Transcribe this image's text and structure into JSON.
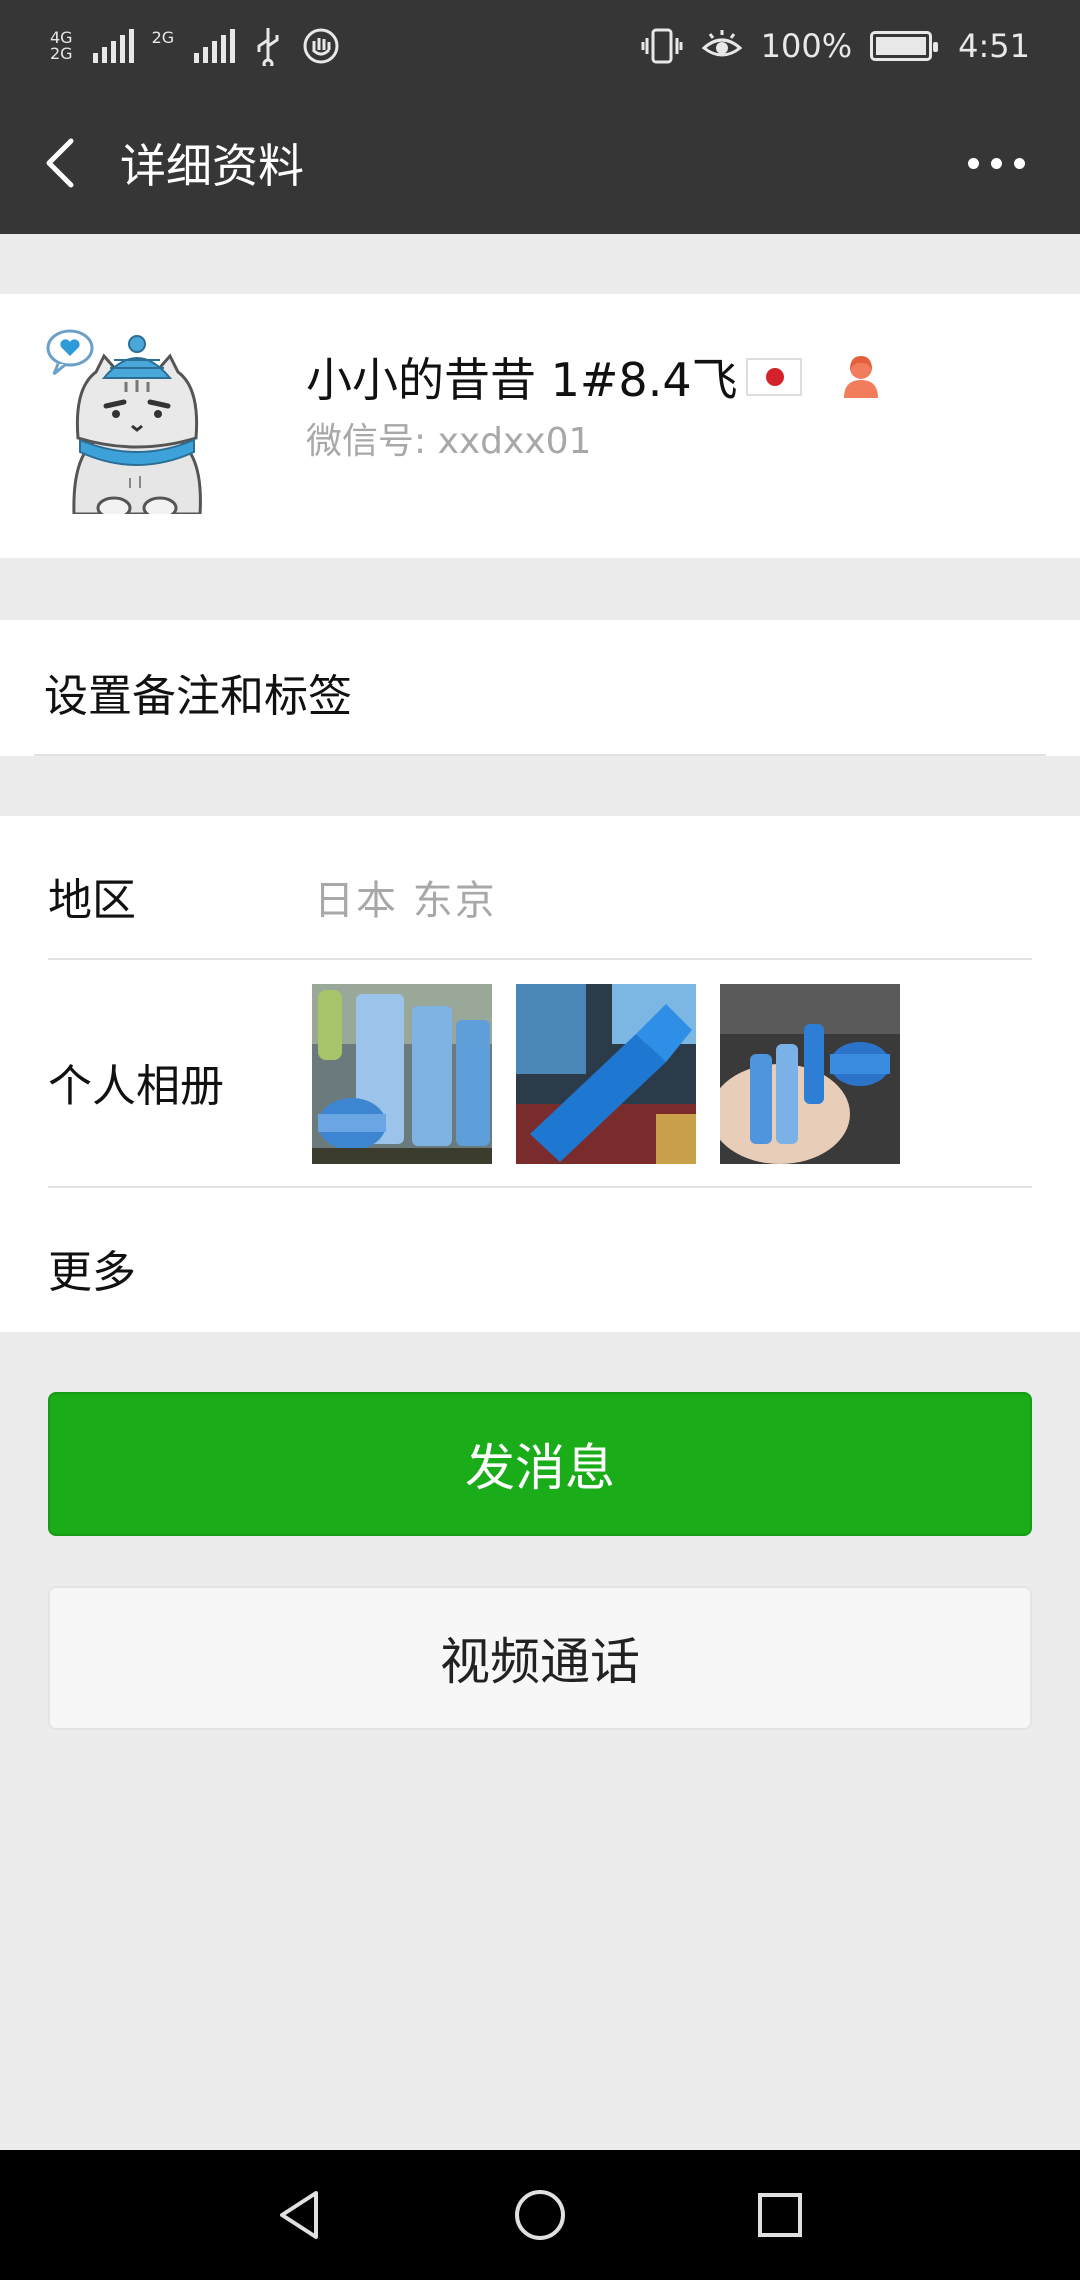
{
  "status_bar": {
    "net1": [
      "4G",
      "2G"
    ],
    "net2": "2G",
    "battery": "100%",
    "time": "4:51"
  },
  "title_bar": {
    "title": "详细资料"
  },
  "profile": {
    "nickname": "小小的昔昔 1#8.4飞",
    "wechat_id": "微信号: xxdxx01"
  },
  "remark": {
    "label": "设置备注和标签"
  },
  "info": {
    "region_label": "地区",
    "region_value": "日本  东京",
    "album_label": "个人相册",
    "more_label": "更多"
  },
  "actions": {
    "message": "发消息",
    "video_call": "视频通话"
  },
  "colors": {
    "header": "#363636",
    "primary": "#1aad19",
    "background": "#ececec"
  }
}
